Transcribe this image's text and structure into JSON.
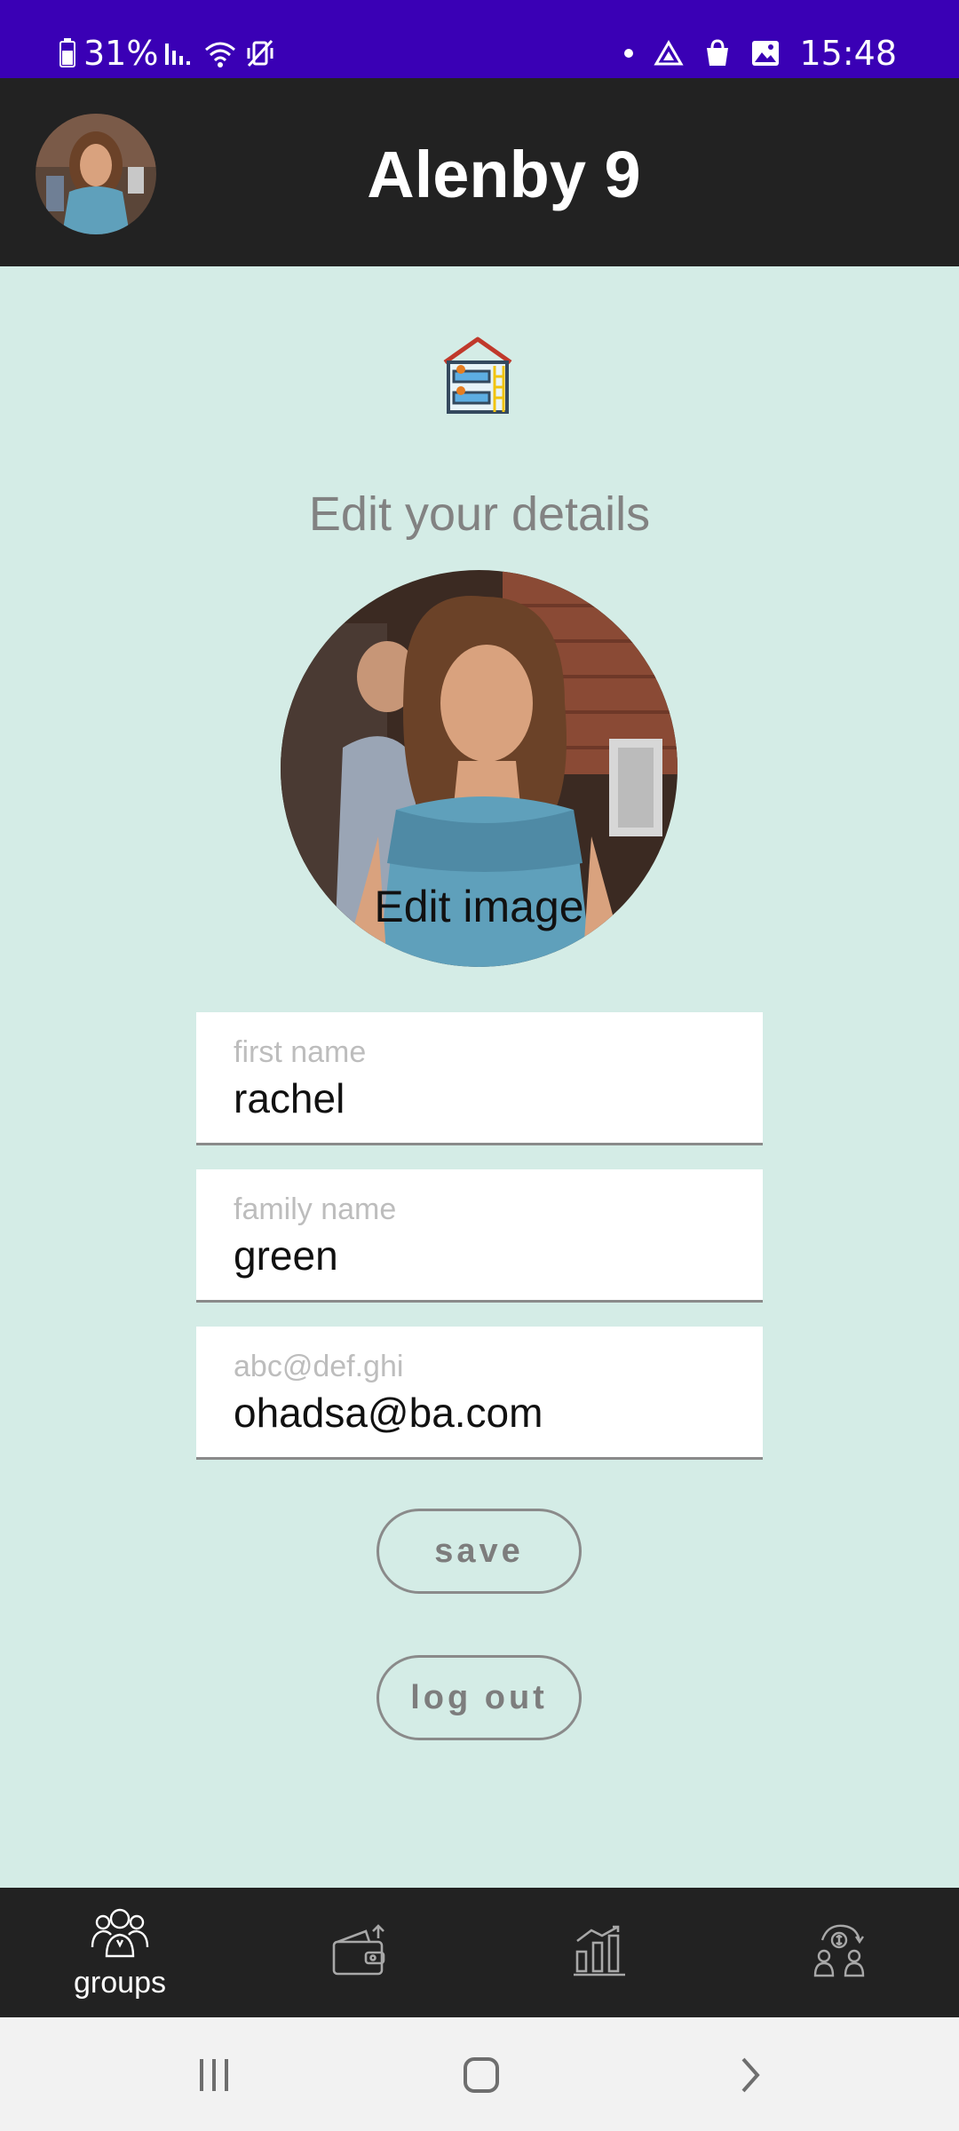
{
  "status_bar": {
    "battery": "31%",
    "time": "15:48",
    "icons": [
      "battery-icon",
      "signal-icon",
      "wifi-icon",
      "vibrate-icon",
      "dot-icon",
      "drive-icon",
      "shopping-bag-icon",
      "gallery-icon"
    ]
  },
  "app_bar": {
    "title": "Alenby 9",
    "avatar_icon": "user-avatar"
  },
  "content": {
    "logo_icon": "bunk-bed-house-icon",
    "heading": "Edit your details",
    "edit_image_label": "Edit image"
  },
  "form": {
    "first_name": {
      "placeholder": "first name",
      "value": "rachel"
    },
    "family_name": {
      "placeholder": "family name",
      "value": "green"
    },
    "email": {
      "placeholder": "abc@def.ghi",
      "value": "ohadsa@ba.com"
    }
  },
  "buttons": {
    "save": "save",
    "logout": "log out"
  },
  "bottom_nav": {
    "items": [
      {
        "icon": "groups-icon",
        "label": "groups"
      },
      {
        "icon": "wallet-icon",
        "label": ""
      },
      {
        "icon": "bar-chart-icon",
        "label": ""
      },
      {
        "icon": "debt-users-icon",
        "label": ""
      }
    ]
  },
  "system_nav": [
    "recents-button",
    "home-button",
    "back-button"
  ],
  "colors": {
    "status_bar": "#3a00b5",
    "app_bar": "#222222",
    "background": "#d4ece6",
    "muted_text": "#828282"
  }
}
